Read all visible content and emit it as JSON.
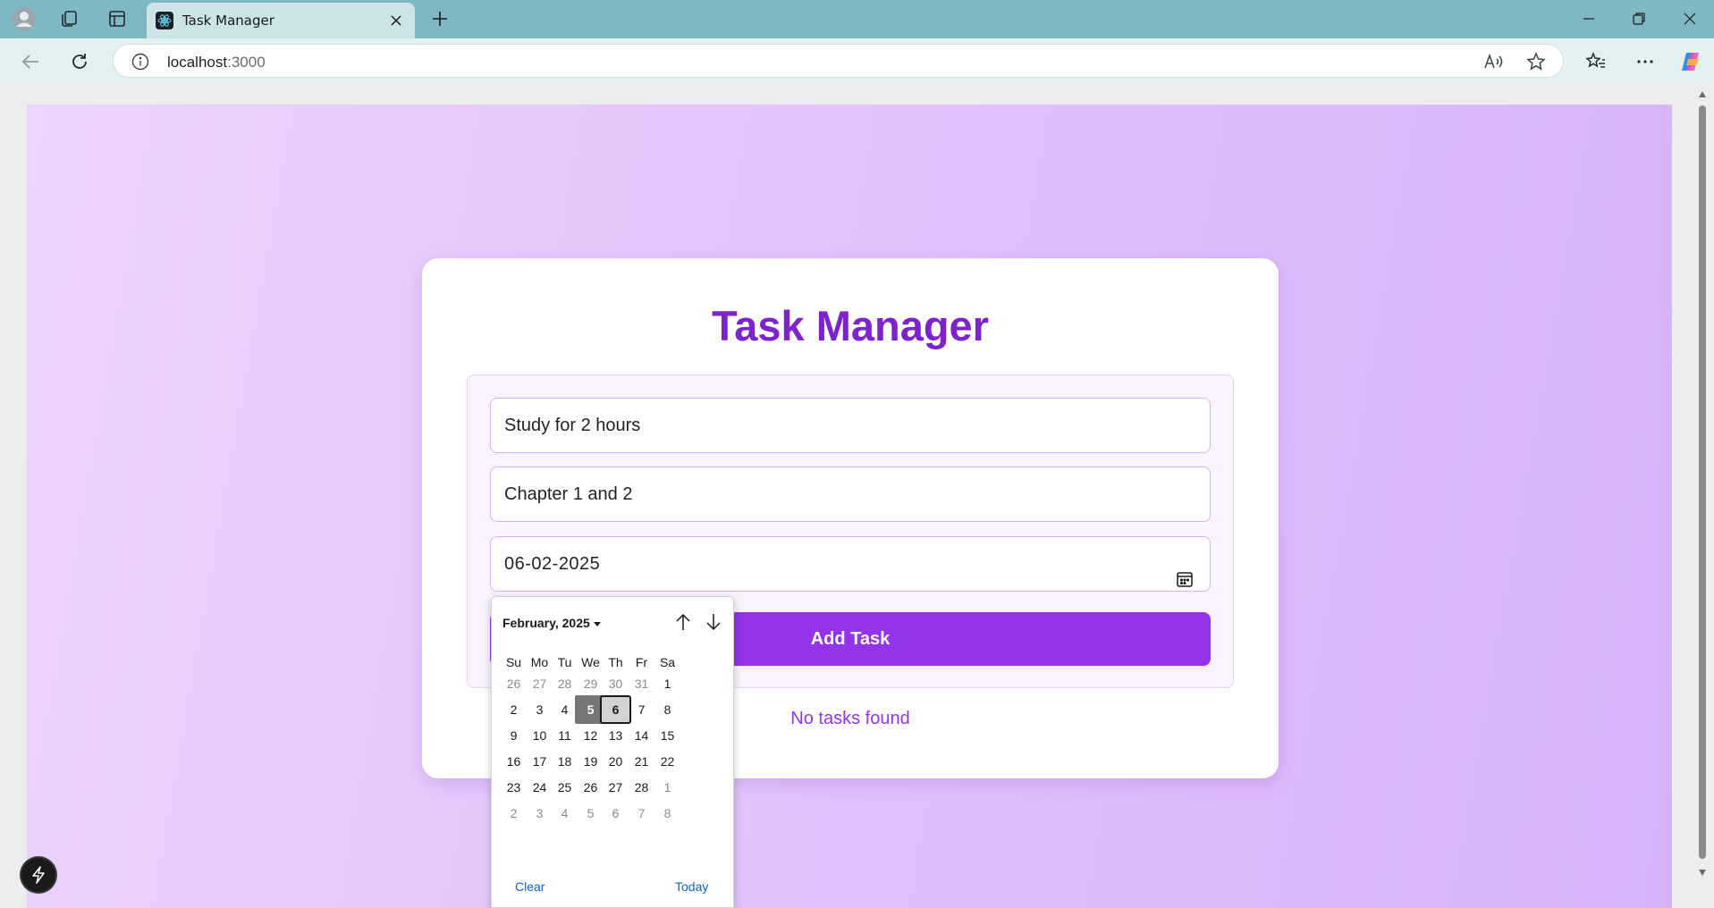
{
  "browser": {
    "tab_title": "Task Manager",
    "url_host": "localhost",
    "url_port": ":3000"
  },
  "app": {
    "title": "Task Manager",
    "task_title_value": "Study for 2 hours",
    "task_description_value": "Chapter 1 and 2",
    "due_date_value": "06-02-2025",
    "add_button_label": "Add Task",
    "empty_message": "No tasks found",
    "accent_color": "#9333ea",
    "title_color": "#7e22ce"
  },
  "date_picker": {
    "month_label": "February, 2025",
    "weekdays": [
      "Su",
      "Mo",
      "Tu",
      "We",
      "Th",
      "Fr",
      "Sa"
    ],
    "weeks": [
      [
        "26",
        "27",
        "28",
        "29",
        "30",
        "31",
        "1"
      ],
      [
        "2",
        "3",
        "4",
        "5",
        "6",
        "7",
        "8"
      ],
      [
        "9",
        "10",
        "11",
        "12",
        "13",
        "14",
        "15"
      ],
      [
        "16",
        "17",
        "18",
        "19",
        "20",
        "21",
        "22"
      ],
      [
        "23",
        "24",
        "25",
        "26",
        "27",
        "28",
        "1"
      ],
      [
        "2",
        "3",
        "4",
        "5",
        "6",
        "7",
        "8"
      ]
    ],
    "selected_day": "5",
    "today_day": "6",
    "clear_label": "Clear",
    "today_label": "Today"
  }
}
